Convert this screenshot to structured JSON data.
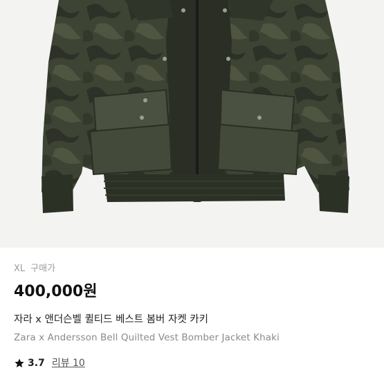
{
  "product": {
    "image_alt": "Quilted camo bomber jacket",
    "size": "XL",
    "purchase_label": "구매가",
    "price": "400,000원",
    "title_ko": "자라 x 앤더슨벨 퀼티드 베스트 봄버 자켓 카키",
    "title_en": "Zara x Andersson Bell Quilted Vest Bomber Jacket Khaki",
    "rating": "3.7",
    "reviews_label": "리뷰 10"
  },
  "colors": {
    "jacket_base": "#3e4434",
    "jacket_shadow": "#262a22",
    "jacket_highlight": "#5a6148",
    "background": "#f3f3f1",
    "price_text": "#111111",
    "muted_text": "#9b9b9b"
  },
  "icons": {
    "rating": "star-icon"
  }
}
